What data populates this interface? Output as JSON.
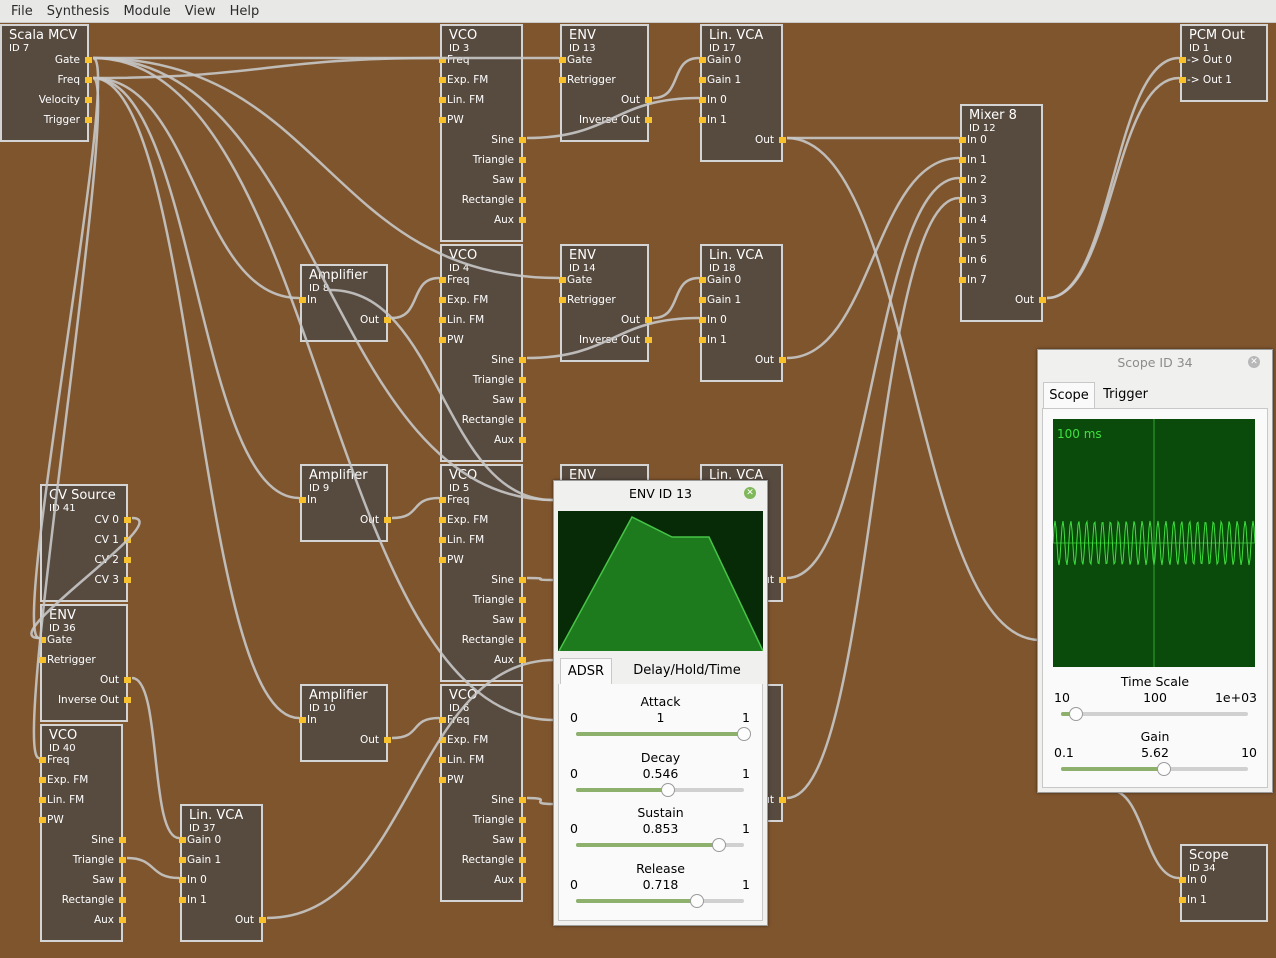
{
  "menu": [
    "File",
    "Synthesis",
    "Module",
    "View",
    "Help"
  ],
  "modules": {
    "scala_mcv": {
      "title": "Scala MCV",
      "id": "ID 7",
      "outputs": [
        "Gate",
        "Freq",
        "Velocity",
        "Trigger"
      ]
    },
    "vco_3": {
      "title": "VCO",
      "id": "ID 3",
      "inputs": [
        "Freq",
        "Exp. FM",
        "Lin. FM",
        "PW"
      ],
      "outputs": [
        "Sine",
        "Triangle",
        "Saw",
        "Rectangle",
        "Aux"
      ]
    },
    "vco_4": {
      "title": "VCO",
      "id": "ID 4",
      "inputs": [
        "Freq",
        "Exp. FM",
        "Lin. FM",
        "PW"
      ],
      "outputs": [
        "Sine",
        "Triangle",
        "Saw",
        "Rectangle",
        "Aux"
      ]
    },
    "vco_5": {
      "title": "VCO",
      "id": "ID 5",
      "inputs": [
        "Freq",
        "Exp. FM",
        "Lin. FM",
        "PW"
      ],
      "outputs": [
        "Sine",
        "Triangle",
        "Saw",
        "Rectangle",
        "Aux"
      ]
    },
    "vco_6": {
      "title": "VCO",
      "id": "ID 6",
      "inputs": [
        "Freq",
        "Exp. FM",
        "Lin. FM",
        "PW"
      ],
      "outputs": [
        "Sine",
        "Triangle",
        "Saw",
        "Rectangle",
        "Aux"
      ]
    },
    "env_13": {
      "title": "ENV",
      "id": "ID 13",
      "inputs": [
        "Gate",
        "Retrigger"
      ],
      "outputs": [
        "Out",
        "Inverse Out"
      ]
    },
    "env_14": {
      "title": "ENV",
      "id": "ID 14",
      "inputs": [
        "Gate",
        "Retrigger"
      ],
      "outputs": [
        "Out",
        "Inverse Out"
      ]
    },
    "env_hidden": {
      "title": "ENV"
    },
    "vca_17": {
      "title": "Lin. VCA",
      "id": "ID 17",
      "inputs": [
        "Gain 0",
        "Gain 1",
        "In 0",
        "In 1"
      ],
      "outputs": [
        "Out"
      ]
    },
    "vca_18": {
      "title": "Lin. VCA",
      "id": "ID 18",
      "inputs": [
        "Gain 0",
        "Gain 1",
        "In 0",
        "In 1"
      ],
      "outputs": [
        "Out"
      ]
    },
    "vca_hidden": {
      "title": "Lin. VCA",
      "out": "ut"
    },
    "vca_hidden2": {
      "out": "ut"
    },
    "amp_8": {
      "title": "Amplifier",
      "id": "ID 8",
      "inputs": [
        "In"
      ],
      "outputs": [
        "Out"
      ]
    },
    "amp_9": {
      "title": "Amplifier",
      "id": "ID 9",
      "inputs": [
        "In"
      ],
      "outputs": [
        "Out"
      ]
    },
    "amp_10": {
      "title": "Amplifier",
      "id": "ID 10",
      "inputs": [
        "In"
      ],
      "outputs": [
        "Out"
      ]
    },
    "mixer_12": {
      "title": "Mixer 8",
      "id": "ID 12",
      "inputs": [
        "In 0",
        "In 1",
        "In 2",
        "In 3",
        "In 4",
        "In 5",
        "In 6",
        "In 7"
      ],
      "outputs": [
        "Out"
      ]
    },
    "pcm_out": {
      "title": "PCM Out",
      "id": "ID 1",
      "inputs": [
        "-> Out  0",
        "-> Out  1"
      ]
    },
    "cv_source": {
      "title": "CV Source",
      "id": "ID 41",
      "outputs": [
        "CV 0",
        "CV 1",
        "CV 2",
        "CV 3"
      ]
    },
    "env_36": {
      "title": "ENV",
      "id": "ID 36",
      "inputs": [
        "Gate",
        "Retrigger"
      ],
      "outputs": [
        "Out",
        "Inverse Out"
      ]
    },
    "vco_40": {
      "title": "VCO",
      "id": "ID 40",
      "inputs": [
        "Freq",
        "Exp. FM",
        "Lin. FM",
        "PW"
      ],
      "outputs": [
        "Sine",
        "Triangle",
        "Saw",
        "Rectangle",
        "Aux"
      ]
    },
    "vca_37": {
      "title": "Lin. VCA",
      "id": "ID 37",
      "inputs": [
        "Gain 0",
        "Gain 1",
        "In 0",
        "In 1"
      ],
      "outputs": [
        "Out"
      ]
    },
    "scope_34": {
      "title": "Scope",
      "id": "ID 34",
      "inputs": [
        "In 0",
        "In 1"
      ]
    }
  },
  "env_dialog": {
    "title": "ENV ID 13",
    "tabs": [
      "ADSR",
      "Delay/Hold/Time Scale"
    ],
    "active_tab": "ADSR",
    "sliders": [
      {
        "label": "Attack",
        "min": "0",
        "value": "1",
        "max": "1",
        "fraction": 1.0
      },
      {
        "label": "Decay",
        "min": "0",
        "value": "0.546",
        "max": "1",
        "fraction": 0.546
      },
      {
        "label": "Sustain",
        "min": "0",
        "value": "0.853",
        "max": "1",
        "fraction": 0.853
      },
      {
        "label": "Release",
        "min": "0",
        "value": "0.718",
        "max": "1",
        "fraction": 0.718
      }
    ],
    "colors": {
      "graph_bg": "#072b07",
      "envelope_fill": "#1d7a1d",
      "envelope_line": "#47c447"
    }
  },
  "scope_dialog": {
    "title": "Scope ID 34",
    "tabs": [
      "Scope",
      "Trigger"
    ],
    "active_tab": "Scope",
    "time_label": "100 ms",
    "time_scale": {
      "label": "Time Scale",
      "min": "10",
      "value": "100",
      "max": "1e+03",
      "fraction": 0.08
    },
    "gain": {
      "label": "Gain",
      "min": "0.1",
      "value": "5.62",
      "max": "10",
      "fraction": 0.55
    },
    "colors": {
      "screen_bg": "#0a4a0a",
      "trace": "#3fe03f",
      "text": "#40e040"
    }
  },
  "colors": {
    "canvas": "#7f552e",
    "module_bg": "#574b40",
    "module_border": "#d4d4d4",
    "jack": "#f6c12c",
    "wire": "#c8c8c8",
    "slider_fill": "#8db06c"
  }
}
